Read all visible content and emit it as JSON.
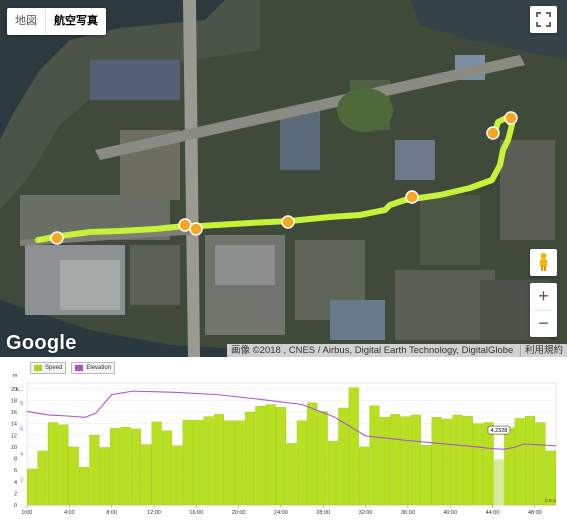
{
  "map": {
    "type_buttons": [
      {
        "label": "地図"
      },
      {
        "label": "航空写真"
      }
    ],
    "fullscreen_icon": "fullscreen-icon",
    "pegman_icon": "pegman-icon",
    "zoom_in_label": "+",
    "zoom_out_label": "−",
    "logo_text": "Google",
    "attribution": "画像 ©2018 , CNES / Airbus, Digital Earth Technology, DigitalGlobe",
    "terms_link": "利用規約",
    "route_color": "#c6f23a"
  },
  "chart_legend": {
    "speed_label": "Speed",
    "elevation_label": "Elevation",
    "speed_color": "#a8d81c",
    "elevation_color": "#b050d0"
  },
  "chart_data": {
    "type": "bar",
    "x_unit_label": "h:m:s",
    "y_unit_label_left": "m",
    "y_unit_label_right": "k...",
    "x_ticks": [
      "0:00",
      "4:00",
      "8:00",
      "12:00",
      "16:00",
      "20:00",
      "24:00",
      "28:00",
      "32:00",
      "36:00",
      "40:00",
      "44:00",
      "48:00"
    ],
    "x_max": 50,
    "y_ticks": [
      0,
      2,
      4,
      6,
      8,
      10,
      12,
      14,
      16,
      18,
      20
    ],
    "ylim": [
      0,
      21
    ],
    "right_ticks": [
      2,
      4,
      6,
      8
    ],
    "tooltip_text": "4.2328",
    "series": [
      {
        "name": "Speed",
        "type": "bar",
        "values": [
          6.2,
          9.3,
          14.2,
          13.8,
          10.0,
          6.5,
          12.0,
          9.9,
          13.2,
          13.4,
          13.1,
          10.4,
          14.3,
          12.8,
          10.2,
          14.6,
          14.6,
          15.2,
          15.6,
          14.5,
          14.5,
          16.0,
          17.0,
          17.3,
          16.8,
          10.6,
          14.5,
          17.6,
          16.1,
          11.0,
          16.7,
          20.2,
          10.0,
          17.1,
          15.1,
          15.6,
          15.2,
          15.5,
          10.3,
          15.1,
          14.8,
          15.5,
          15.3,
          14.0,
          14.2,
          7.8,
          13.3,
          14.9,
          15.3,
          14.2,
          9.3
        ]
      },
      {
        "name": "Elevation",
        "type": "line",
        "points": [
          [
            0,
            16.1
          ],
          [
            2,
            15.5
          ],
          [
            4,
            15.3
          ],
          [
            5.5,
            15.1
          ],
          [
            6.5,
            15.8
          ],
          [
            8,
            19.0
          ],
          [
            10,
            19.6
          ],
          [
            14,
            19.4
          ],
          [
            18,
            19.0
          ],
          [
            22,
            18.2
          ],
          [
            26,
            17.3
          ],
          [
            29,
            15.2
          ],
          [
            32,
            11.9
          ],
          [
            36,
            11.1
          ],
          [
            39,
            10.6
          ],
          [
            42,
            10.1
          ],
          [
            44,
            9.7
          ],
          [
            45,
            9.6
          ],
          [
            46,
            9.9
          ],
          [
            47,
            10.5
          ],
          [
            50,
            10.2
          ]
        ]
      }
    ],
    "highlight_index": 45
  }
}
